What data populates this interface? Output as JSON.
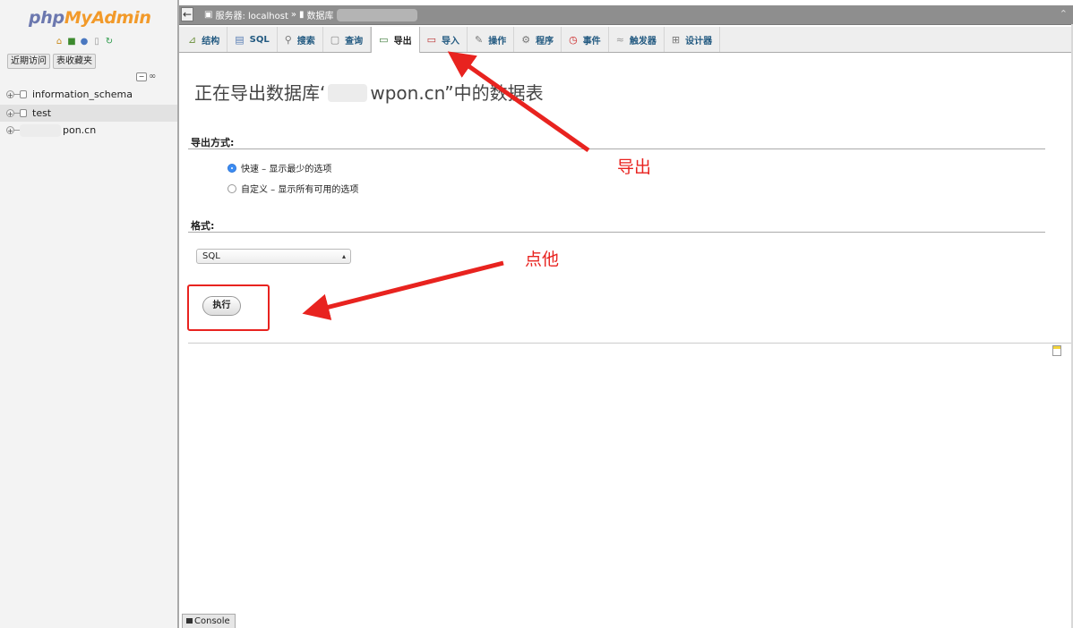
{
  "nav": {
    "logo_php": "php",
    "logo_myadmin": "MyAdmin",
    "icons": [
      "home-icon",
      "exit-icon",
      "help-icon",
      "docs-icon",
      "reload-icon"
    ],
    "links": [
      "近期访问",
      "表收藏夹"
    ],
    "databases": [
      {
        "label": "information_schema"
      },
      {
        "label": "test"
      },
      {
        "label": "pon.cn"
      }
    ]
  },
  "topbar": {
    "breadcrumb_server": "服务器: localhost",
    "separator": "»",
    "breadcrumb_db": "数据库"
  },
  "tabs": [
    {
      "label": "结构",
      "icon": "structure-icon"
    },
    {
      "label": "SQL",
      "icon": "sql-icon"
    },
    {
      "label": "搜索",
      "icon": "search-icon"
    },
    {
      "label": "查询",
      "icon": "query-icon"
    },
    {
      "label": "导出",
      "icon": "export-icon",
      "active": true
    },
    {
      "label": "导入",
      "icon": "import-icon"
    },
    {
      "label": "操作",
      "icon": "wrench-icon"
    },
    {
      "label": "程序",
      "icon": "routines-icon"
    },
    {
      "label": "事件",
      "icon": "clock-icon"
    },
    {
      "label": "触发器",
      "icon": "trigger-icon"
    },
    {
      "label": "设计器",
      "icon": "designer-icon"
    }
  ],
  "main": {
    "title_prefix": "正在导出数据库‘",
    "title_suffix": "wpon.cn”中的数据表",
    "export_method_label": "导出方式:",
    "options": [
      {
        "label": "快速 – 显示最少的选项",
        "checked": true
      },
      {
        "label": "自定义 – 显示所有可用的选项",
        "checked": false
      }
    ],
    "format_label": "格式:",
    "format_selected": "SQL",
    "execute_label": "执行"
  },
  "annotations": {
    "export_note": "导出",
    "click_note": "点他",
    "color": "#e8231f"
  },
  "console": {
    "label": "Console"
  }
}
